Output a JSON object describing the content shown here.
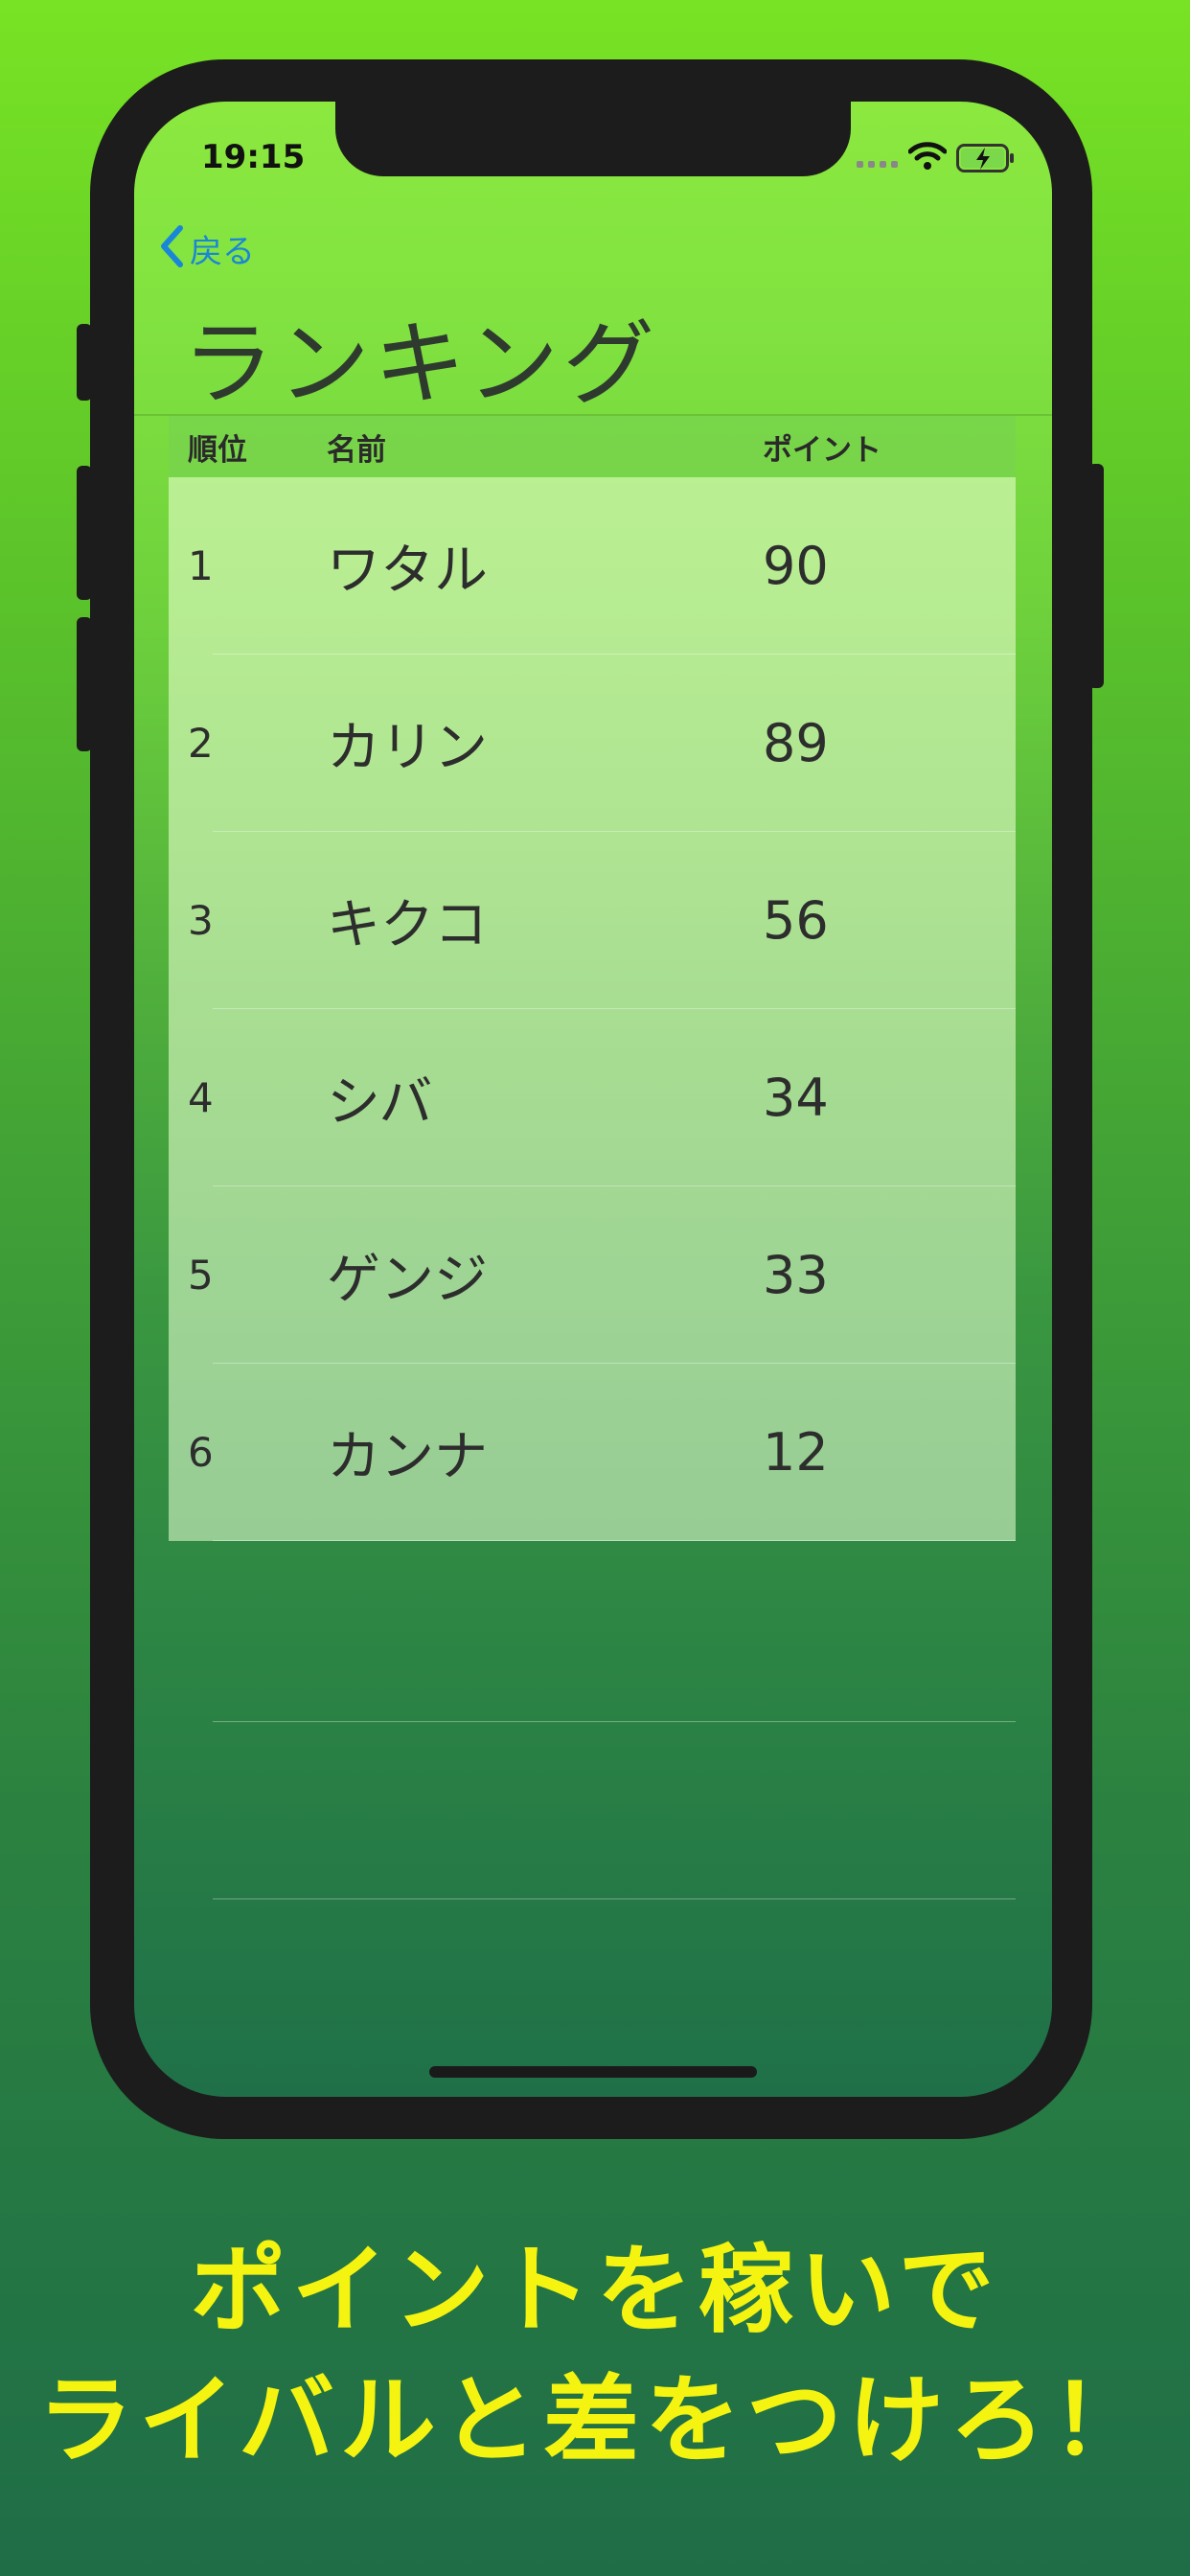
{
  "status_bar": {
    "time": "19:15"
  },
  "nav": {
    "back_label": "戻る",
    "title": "ランキング"
  },
  "table": {
    "headers": {
      "rank": "順位",
      "name": "名前",
      "points": "ポイント"
    },
    "rows": [
      {
        "rank": "1",
        "name": "ワタル",
        "points": "90"
      },
      {
        "rank": "2",
        "name": "カリン",
        "points": "89"
      },
      {
        "rank": "3",
        "name": "キクコ",
        "points": "56"
      },
      {
        "rank": "4",
        "name": "シバ",
        "points": "34"
      },
      {
        "rank": "5",
        "name": "ゲンジ",
        "points": "33"
      },
      {
        "rank": "6",
        "name": "カンナ",
        "points": "12"
      }
    ]
  },
  "caption": {
    "line1": "ポイントを稼いで",
    "line2": "ライバルと差をつけろ！"
  },
  "colors": {
    "caption": "#f4f410",
    "back_link": "#1a86d8",
    "phone_frame": "#1c1c1c"
  }
}
